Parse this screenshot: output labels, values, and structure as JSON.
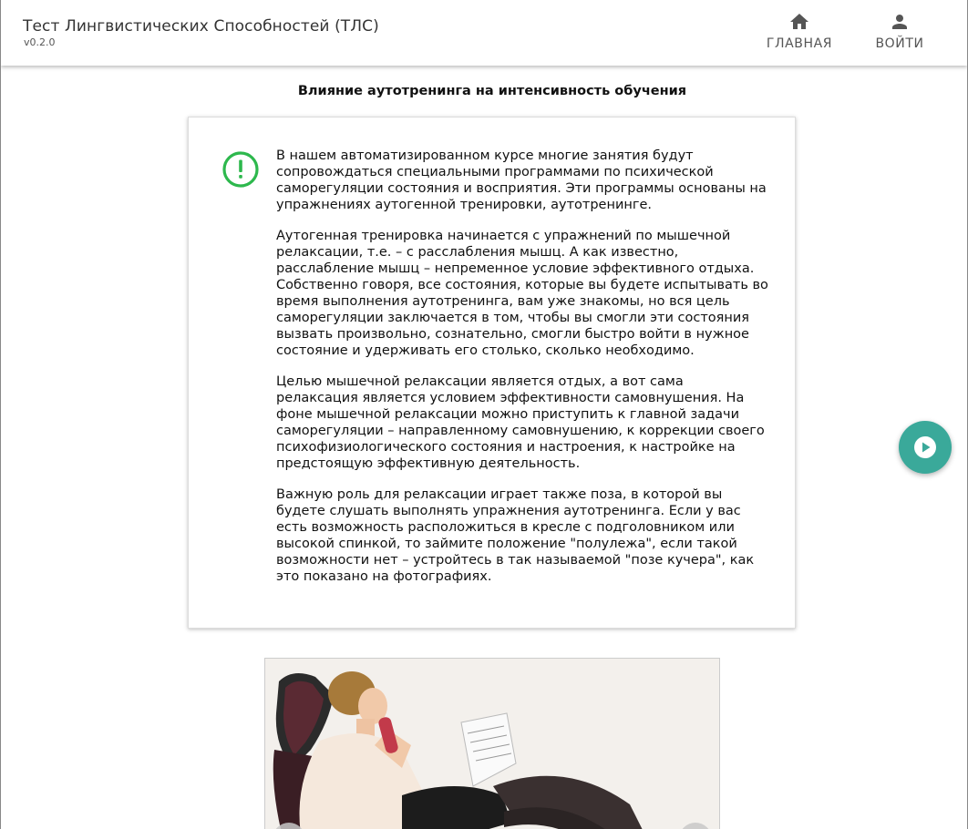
{
  "header": {
    "app_title": "Тест Лингвистических Способностей (ТЛС)",
    "version": "v0.2.0",
    "nav": {
      "home_label": "ГЛАВНАЯ",
      "login_label": "ВОЙТИ"
    }
  },
  "main": {
    "heading": "Влияние аутотренинга на интенсивность обучения",
    "paragraphs": [
      "В нашем автоматизированном курсе многие занятия будут сопровождаться специальными программами по психической саморегуляции состояния и восприятия. Эти программы основаны на упражнениях аутогенной тренировки, аутотренинге.",
      "Аутогенная тренировка начинается с упражнений по мышечной релаксации, т.е. – с расслабления мышц. А как известно, расслабление мышц – непременное условие эффективного отдыха. Собственно говоря, все состояния, которые вы будете испытывать во время выполнения аутотренинга, вам уже знакомы, но вся цель саморегуляции заключается в том, чтобы вы смогли эти состояния вызвать произвольно, сознательно, смогли быстро войти в нужное состояние и удерживать его столько, сколько необходимо.",
      "Целью мышечной релаксации является отдых, а вот сама релаксация является условием эффективности самовнушения. На фоне мышечной релаксации можно приступить к главной задачи саморегуляции – направленному самовнушению, к коррекции своего психофизиологического состояния и настроения, к настройке на предстоящую эффективную деятельность.",
      "Важную роль для релаксации играет также поза, в которой вы будете слушать выполнять упражнения аутотренинга. Если у вас есть возможность расположиться в кресле с подголовником или высокой спинкой, то займите положение \"полулежа\", если такой возможности нет – устройтесь в так называемой \"позе кучера\", как это показано на фотографиях."
    ]
  },
  "icons": {
    "alert": "exclamation-circle-icon",
    "home": "home-icon",
    "login": "person-icon",
    "play": "play-circle-icon"
  },
  "colors": {
    "alert_green": "#2db84d",
    "fab_teal": "#3aa99a",
    "nav_gray": "#555555"
  }
}
